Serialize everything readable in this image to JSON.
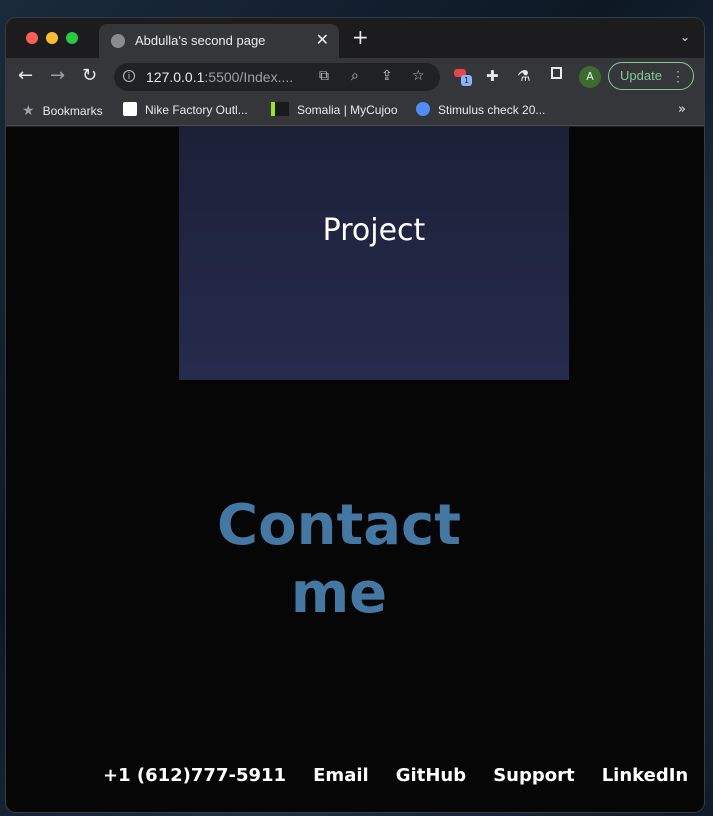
{
  "browser": {
    "tab_title": "Abdulla's second page",
    "tab_close": "✕",
    "new_tab": "+",
    "tab_menu": "⌄",
    "url_host": "127.0.0.1",
    "url_rest": ":5500/Index....",
    "update_label": "Update",
    "update_menu": "⋮",
    "avatar_letter": "A",
    "extension_badge": "1"
  },
  "bookmarks": {
    "items": [
      {
        "label": "Bookmarks"
      },
      {
        "label": "Nike Factory Outl..."
      },
      {
        "label": "Somalia | MyCujoo"
      },
      {
        "label": "Stimulus check 20..."
      }
    ],
    "more": "»"
  },
  "page": {
    "project_title": "Project",
    "contact_heading_line1": "Contact",
    "contact_heading_line2": "me",
    "footer_links": [
      "+1 (612)777-5911",
      "Email",
      "GitHub",
      "Support",
      "LinkedIn"
    ]
  },
  "colors": {
    "contact_heading": "#4577a3",
    "project_box": "#232846",
    "page_background": "#060607",
    "update_accent": "#81c995"
  }
}
